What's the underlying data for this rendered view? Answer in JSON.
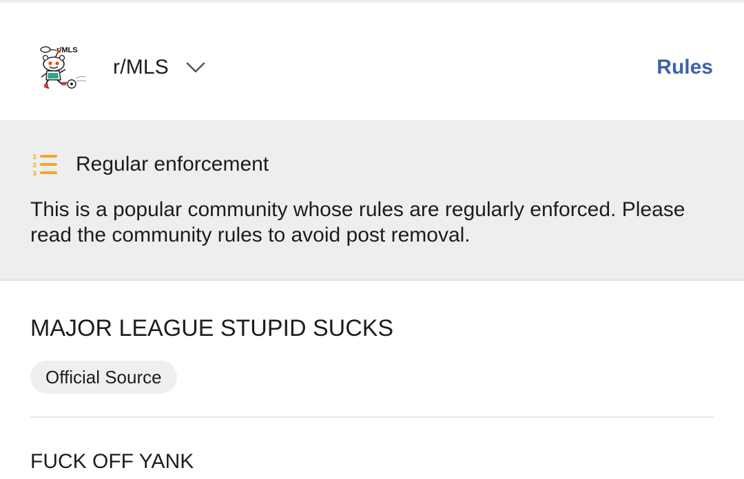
{
  "header": {
    "avatar_text": "r/MLS",
    "community_name": "r/MLS",
    "rules_label": "Rules"
  },
  "notice": {
    "title": "Regular enforcement",
    "body": "This is a popular community whose rules are regularly enforced. Please read the community rules to avoid post removal.",
    "icon": "numbered-list-icon",
    "icon_color": "#f5a623"
  },
  "content": {
    "title": "MAJOR LEAGUE STUPID SUCKS",
    "flair": "Official Source",
    "description": "FUCK OFF YANK"
  },
  "colors": {
    "accent": "#3a63a8",
    "notice_bg": "#edeef0"
  }
}
